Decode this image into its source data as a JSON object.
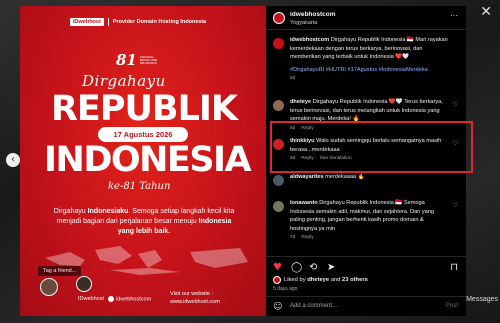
{
  "window": {
    "close_glyph": "✕",
    "prev_glyph": "‹",
    "side_text": "Messages"
  },
  "post": {
    "brand_logo": "IDwebhost",
    "brand_tagline": "Provider Domain Hosting Indonesia",
    "logo_number": "81",
    "logo_text": "INDONESIA BERSATU BER DIRI MAKMUR",
    "headline_script": "Dirgahayu",
    "headline_1": "REPUBLIK",
    "date": "17 Agustus 2026",
    "headline_2": "INDONESIA",
    "anniv": "ke-81 Tahun",
    "greeting_pre": "Dirgahayu ",
    "greeting_bold": "Indonesiaku",
    "greeting_mid": ". Semoga setiap langkah kecil kita menjadi bagian dari perjalanan besar menuju ",
    "greeting_end": "Indonesia yang lebih baik.",
    "tag_friend": "Tag a friend...",
    "footer_logo": "IDwebhost",
    "footer_handle": "idwebhostcom",
    "footer_visit": "Visit our website :",
    "footer_url": "www.idwebhost.com"
  },
  "sidebar": {
    "username": "idwebhostcom",
    "location": "Yogyakarta",
    "more_glyph": "···",
    "caption": {
      "user": "idwebhostcom",
      "text": " Dirgahayu Republik Indonesia 🇮🇩 Mari rayakan kemerdekaan dengan terus berkarya, berinovasi, dan memberikan yang terbaik untuk Indonesia ❤️🤍",
      "hashtags": "#DirgahayuRI #HUTRI #17Agustus #IndonesiaMerdeka",
      "time": "8d"
    },
    "comments": [
      {
        "user": "dheteye",
        "text": " Dirgahayu Republik Indonesia ❤️🤍 Terus berkarya, terus berinovasi, dan terus melangkah untuk Indonesia yang semakin maju. Merdeka! 🔥",
        "time": "8d",
        "reply": "Reply",
        "translation": ""
      },
      {
        "user": "thinkkiyu",
        "text": " Walo sudah semingqu berlalu semangatnya masih berasa...merdekaaa",
        "time": "6d",
        "reply": "Reply",
        "translation": "See translation"
      },
      {
        "user": "aldwayarites",
        "text": " merdekaaaa 🔥",
        "time": "",
        "reply": "",
        "translation": ""
      },
      {
        "user": "lonawanto",
        "text": " Dirgahayu Republik Indonesia 🇮🇩 Semoga Indonesia semakin adil, makmur, dan sejahtera. Dan yang paling penting, jangan berhenti kasih promo domain & hostingnya ya min",
        "time": "7d",
        "reply": "Reply",
        "translation": ""
      }
    ],
    "likes_prefix": "Liked by ",
    "likes_user": "dheteye",
    "likes_and": " and ",
    "likes_count": "23 others",
    "ago": "5 days ago",
    "add_comment_placeholder": "Add a comment...",
    "post_label": "Post"
  },
  "colors": {
    "brand_red": "#c4121a",
    "highlight": "#e3262b",
    "link_blue": "#8bb4ff"
  }
}
